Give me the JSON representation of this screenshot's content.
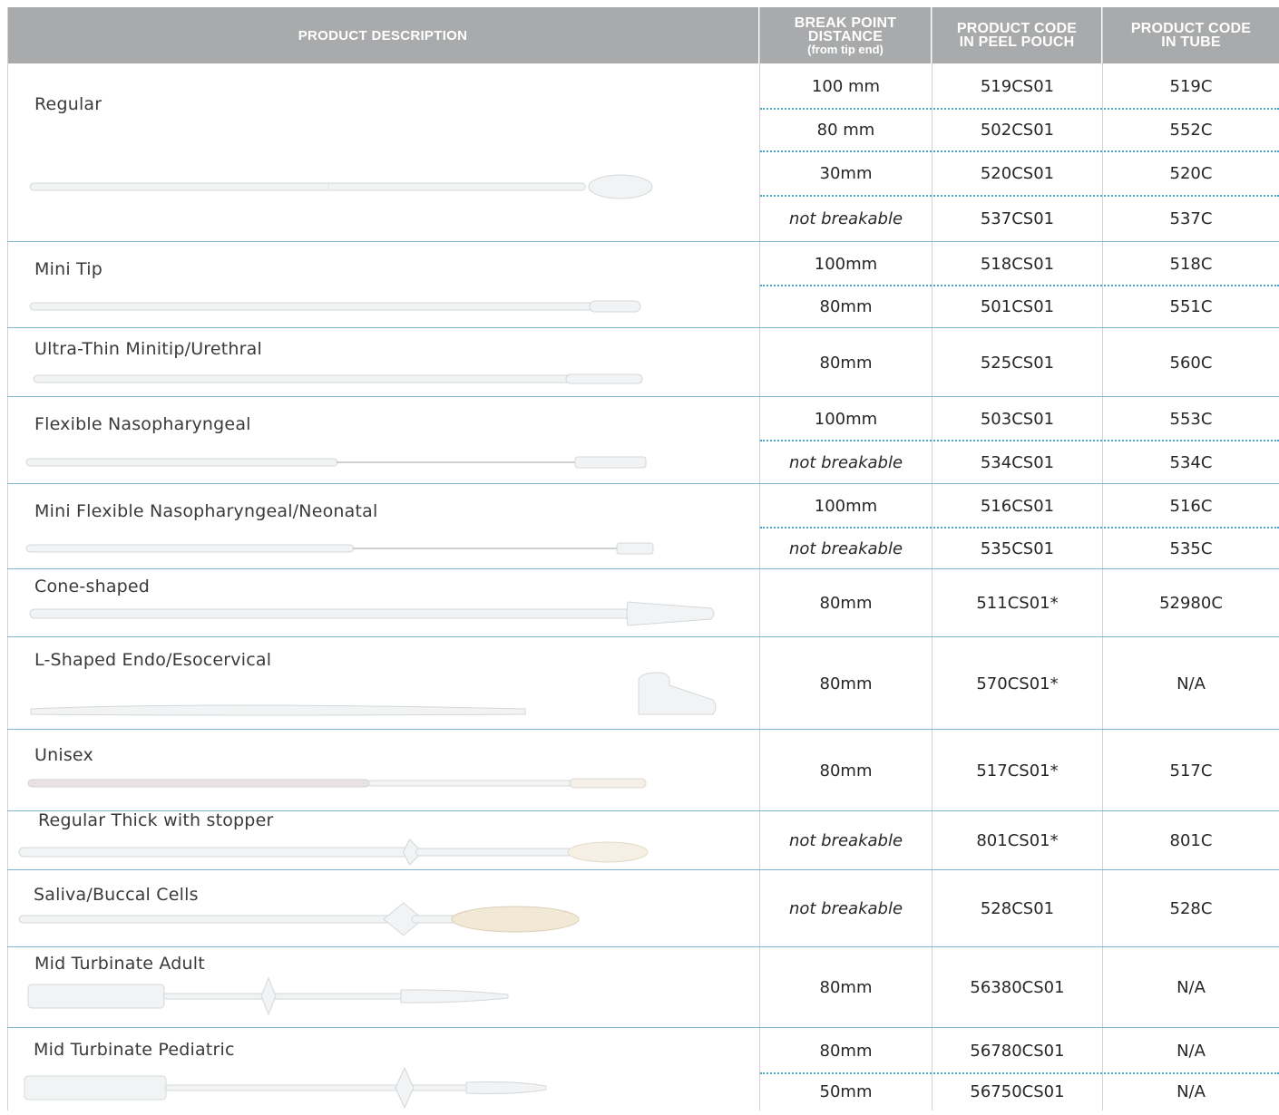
{
  "header": {
    "description": "PRODUCT DESCRIPTION",
    "break_point": [
      "BREAK POINT",
      "DISTANCE"
    ],
    "break_point_sub": "(from tip end)",
    "peel_pouch": [
      "PRODUCT CODE",
      "IN PEEL POUCH"
    ],
    "tube": [
      "PRODUCT CODE",
      "IN TUBE"
    ]
  },
  "products": [
    {
      "name": "Regular",
      "variants": [
        {
          "distance": "100 mm",
          "peel": "519CS01",
          "tube": "519C"
        },
        {
          "distance": "80 mm",
          "peel": "502CS01",
          "tube": "552C"
        },
        {
          "distance": "30mm",
          "peel": "520CS01",
          "tube": "520C"
        },
        {
          "distance": "not breakable",
          "peel": "537CS01",
          "tube": "537C"
        }
      ]
    },
    {
      "name": "Mini Tip",
      "variants": [
        {
          "distance": "100mm",
          "peel": "518CS01",
          "tube": "518C"
        },
        {
          "distance": "80mm",
          "peel": "501CS01",
          "tube": "551C"
        }
      ]
    },
    {
      "name": "Ultra-Thin Minitip/Urethral",
      "variants": [
        {
          "distance": "80mm",
          "peel": "525CS01",
          "tube": "560C"
        }
      ]
    },
    {
      "name": "Flexible Nasopharyngeal",
      "variants": [
        {
          "distance": "100mm",
          "peel": "503CS01",
          "tube": "553C"
        },
        {
          "distance": "not breakable",
          "peel": "534CS01",
          "tube": "534C"
        }
      ]
    },
    {
      "name": "Mini Flexible Nasopharyngeal/Neonatal",
      "variants": [
        {
          "distance": "100mm",
          "peel": "516CS01",
          "tube": "516C"
        },
        {
          "distance": "not breakable",
          "peel": "535CS01",
          "tube": "535C"
        }
      ]
    },
    {
      "name": "Cone-shaped",
      "variants": [
        {
          "distance": "80mm",
          "peel": "511CS01*",
          "tube": "52980C"
        }
      ]
    },
    {
      "name": "L-Shaped Endo/Esocervical",
      "variants": [
        {
          "distance": "80mm",
          "peel": "570CS01*",
          "tube": "N/A"
        }
      ]
    },
    {
      "name": "Unisex",
      "variants": [
        {
          "distance": "80mm",
          "peel": "517CS01*",
          "tube": "517C"
        }
      ]
    },
    {
      "name": "Regular Thick with stopper",
      "variants": [
        {
          "distance": "not breakable",
          "peel": "801CS01*",
          "tube": "801C"
        }
      ]
    },
    {
      "name": "Saliva/Buccal Cells",
      "variants": [
        {
          "distance": "not breakable",
          "peel": "528CS01",
          "tube": "528C"
        }
      ]
    },
    {
      "name": "Mid Turbinate Adult",
      "variants": [
        {
          "distance": "80mm",
          "peel": "56380CS01",
          "tube": "N/A"
        }
      ]
    },
    {
      "name": "Mid Turbinate Pediatric",
      "variants": [
        {
          "distance": "80mm",
          "peel": "56780CS01",
          "tube": "N/A"
        },
        {
          "distance": "50mm",
          "peel": "56750CS01",
          "tube": "N/A"
        }
      ]
    }
  ],
  "colors": {
    "header_bg": "#a9aaab",
    "row_separator": "#7fb4d0",
    "dotted_separator": "#4aa3cc",
    "swab_fill": "#f1f3f4"
  }
}
